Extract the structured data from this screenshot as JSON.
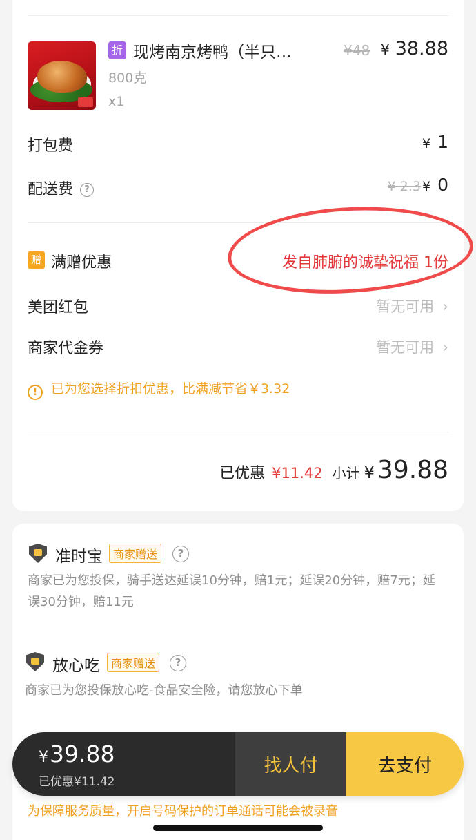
{
  "product": {
    "discount_badge": "折",
    "name": "现烤南京烤鸭（半只…",
    "original_price": "¥48",
    "currency": "¥",
    "price": "38.88",
    "spec": "800克",
    "quantity": "x1"
  },
  "fees": {
    "packing_label": "打包费",
    "packing_value": "1",
    "delivery_label": "配送费",
    "delivery_original": "¥ 2.3",
    "delivery_value": "0"
  },
  "promotions": {
    "gift_badge": "赠",
    "gift_label": "满赠优惠",
    "gift_value": "发自肺腑的诚挚祝福 1份",
    "red_packet_label": "美团红包",
    "red_packet_value": "暂无可用",
    "voucher_label": "商家代金券",
    "voucher_value": "暂无可用",
    "tip": "已为您选择折扣优惠，比满减节省￥3.32"
  },
  "summary": {
    "discount_label": "已优惠",
    "discount_value": "¥11.42",
    "subtotal_label": "小计",
    "subtotal_value": "39.88"
  },
  "insurance": {
    "ontime_title": "准时宝",
    "ontime_tag": "商家赠送",
    "ontime_desc": "商家已为您投保，骑手送达延误10分钟，赔1元；延误20分钟，赔7元；延误30分钟，赔11元",
    "safe_title": "放心吃",
    "safe_tag": "商家赠送",
    "safe_desc": "商家已为您投保放心吃-食品安全险，请您放心下单"
  },
  "paybar": {
    "amount": "39.88",
    "saved": "已优惠¥11.42",
    "friend_pay": "找人付",
    "pay_now": "去支付"
  },
  "record_note": "为保障服务质量，开启号码保护的订单通话可能会被录音",
  "colors": {
    "accent_yellow": "#f7c843",
    "discount_red": "#e33a3a",
    "tip_orange": "#f0a020",
    "badge_purple": "#a566e8"
  }
}
